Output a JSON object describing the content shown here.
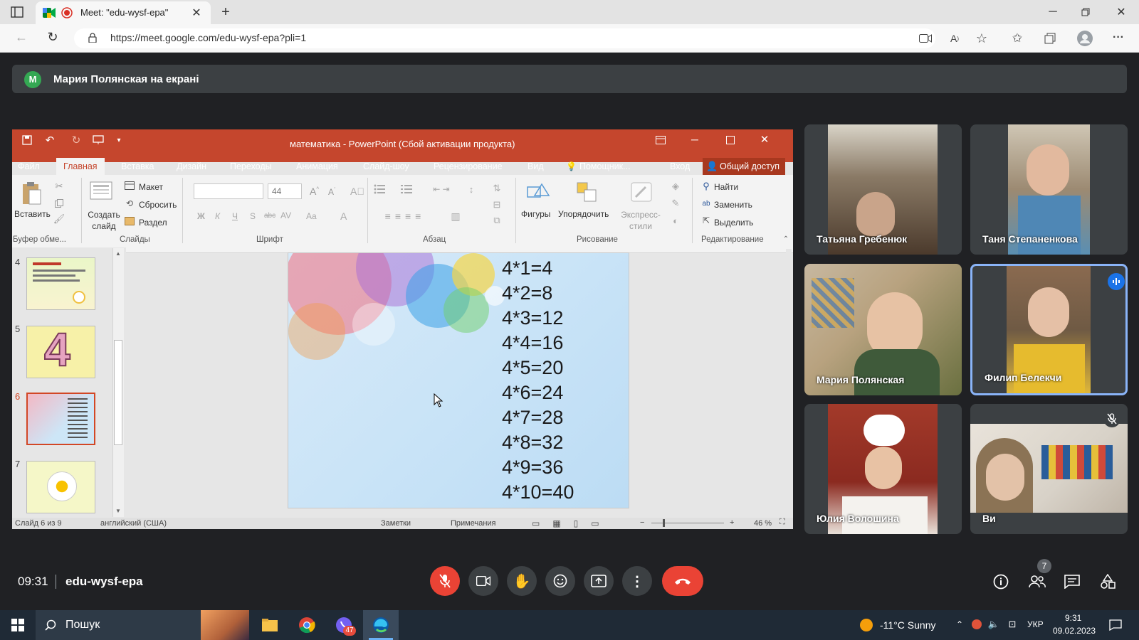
{
  "browser": {
    "tab_title": "Meet: \"edu-wysf-epa\"",
    "url": "https://meet.google.com/edu-wysf-epa?pli=1"
  },
  "presenter_banner": {
    "avatar_letter": "M",
    "text": "Мария Полянская на екрані"
  },
  "powerpoint": {
    "title": "математика - PowerPoint (Сбой активации продукта)",
    "tabs": [
      "Файл",
      "Главная",
      "Вставка",
      "Дизайн",
      "Переходы",
      "Анимация",
      "Слайд-шоу",
      "Рецензирование",
      "Вид",
      "Помощник...",
      "Вход",
      "Общий доступ"
    ],
    "active_tab": "Главная",
    "ribbon": {
      "paste": "Вставить",
      "new_slide": "Создать слайд",
      "layout": "Макет",
      "reset": "Сбросить",
      "section": "Раздел",
      "font_size": "44",
      "shapes": "Фигуры",
      "arrange": "Упорядочить",
      "express_styles": "Экспресс-стили",
      "find": "Найти",
      "replace": "Заменить",
      "select": "Выделить"
    },
    "groups": [
      "Буфер обме...",
      "Слайды",
      "Шрифт",
      "Абзац",
      "Рисование",
      "Редактирование"
    ],
    "thumb_numbers": [
      "4",
      "5",
      "6",
      "7"
    ],
    "active_thumb": "6",
    "slide_lines": [
      "4*1=4",
      "4*2=8",
      "4*3=12",
      "4*4=16",
      "4*5=20",
      "4*6=24",
      "4*7=28",
      "4*8=32",
      "4*9=36",
      "4*10=40"
    ],
    "status": {
      "slide_of": "Слайд 6 из 9",
      "language": "английский (США)",
      "notes": "Заметки",
      "comments": "Примечания",
      "zoom": "46 %"
    }
  },
  "participants": [
    {
      "name": "Татьяна Гребенюк",
      "muted": false,
      "speaking": false,
      "color": "#8a7a66"
    },
    {
      "name": "Таня Степаненкова",
      "muted": false,
      "speaking": false,
      "color": "#9c8a72"
    },
    {
      "name": "Мария Полянская",
      "muted": false,
      "speaking": false,
      "color": "#b8a27f"
    },
    {
      "name": "Филип Белекчи",
      "muted": false,
      "speaking": true,
      "color": "#6f5a44"
    },
    {
      "name": "Юлия Волошина",
      "muted": false,
      "speaking": false,
      "color": "#a33a2a"
    },
    {
      "name": "Ви",
      "muted": true,
      "speaking": false,
      "color": "#d8d2c8"
    }
  ],
  "meeting": {
    "time": "09:31",
    "code": "edu-wysf-epa",
    "people_count": "7",
    "end_color": "#ea4335"
  },
  "taskbar": {
    "search_placeholder": "Пошук",
    "weather": "-11°C Sunny",
    "lang": "УКР",
    "time": "9:31",
    "date": "09.02.2023",
    "viber_badge": "47"
  }
}
